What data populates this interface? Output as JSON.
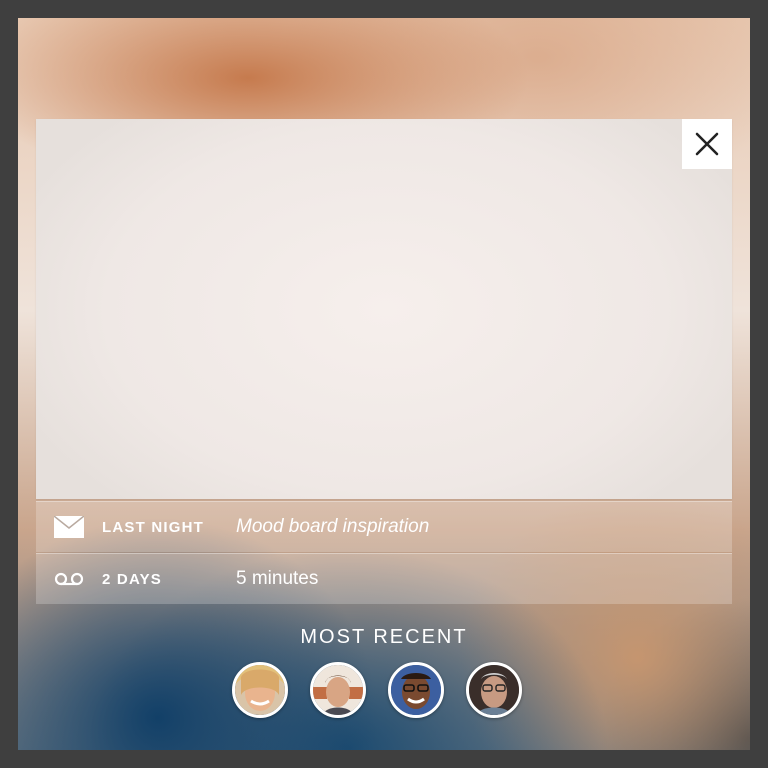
{
  "dialog": {
    "close_icon": "close-icon"
  },
  "notifications": [
    {
      "icon": "mail-icon",
      "when": "LAST NIGHT",
      "subject": "Mood board inspiration"
    },
    {
      "icon": "voicemail-icon",
      "when": "2 DAYS",
      "subject": "5 minutes"
    }
  ],
  "most_recent": {
    "title": "MOST RECENT",
    "contacts": [
      {
        "avatar": "contact-avatar-1"
      },
      {
        "avatar": "contact-avatar-2"
      },
      {
        "avatar": "contact-avatar-3"
      },
      {
        "avatar": "contact-avatar-4"
      }
    ]
  },
  "colors": {
    "background": "#3f3f3f",
    "card": "#f2ebe8",
    "text_light": "#ffffff"
  }
}
